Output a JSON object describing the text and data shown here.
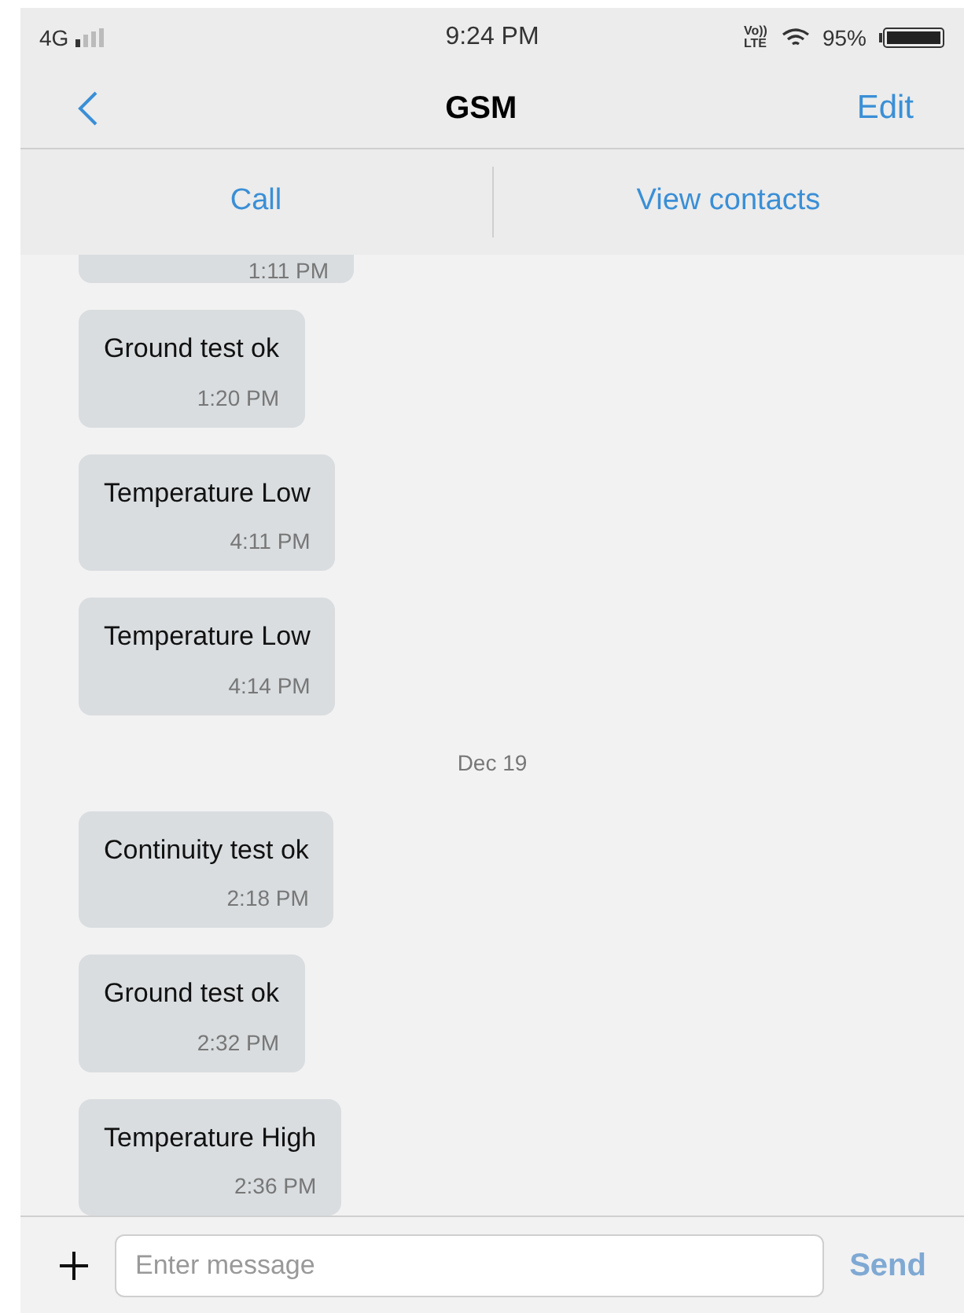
{
  "status_bar": {
    "network": "4G",
    "time": "9:24 PM",
    "volte": "Vo)) LTE",
    "battery": "95%"
  },
  "header": {
    "title": "GSM",
    "edit": "Edit"
  },
  "actions": [
    "Call",
    "View contacts"
  ],
  "messages": [
    {
      "kind": "cut",
      "time": "1:11 PM"
    },
    {
      "kind": "message",
      "text": "Ground test ok",
      "time": "1:20 PM"
    },
    {
      "kind": "message",
      "text": "Temperature Low",
      "time": "4:11 PM"
    },
    {
      "kind": "message",
      "text": "Temperature Low",
      "time": "4:14 PM"
    },
    {
      "kind": "date",
      "text": "Dec 19"
    },
    {
      "kind": "message",
      "text": "Continuity test ok",
      "time": "2:18 PM"
    },
    {
      "kind": "message",
      "text": "Ground test ok",
      "time": "2:32 PM"
    },
    {
      "kind": "message",
      "text": "Temperature High",
      "time": "2:36 PM"
    }
  ],
  "composer": {
    "placeholder": "Enter message",
    "send": "Send",
    "send_disabled": true
  }
}
